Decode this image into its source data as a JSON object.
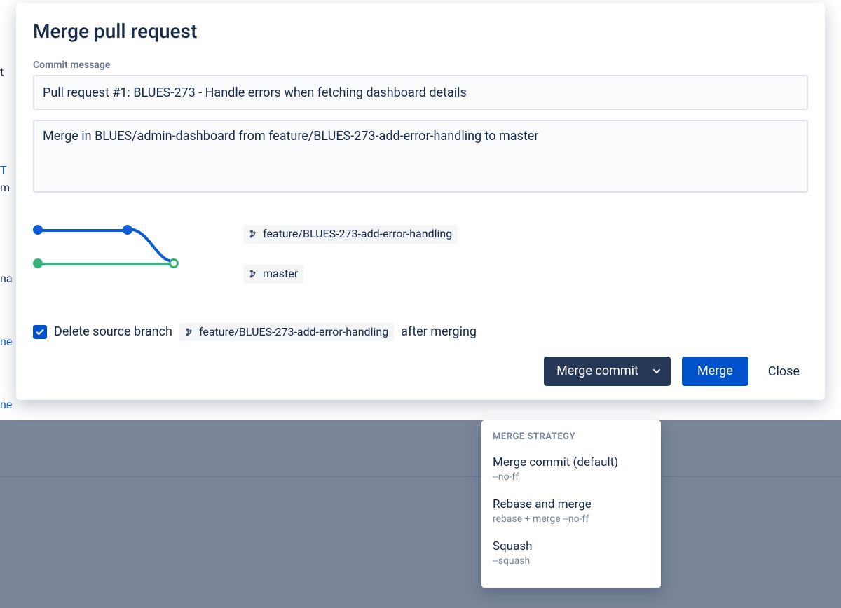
{
  "title": "Merge pull request",
  "field_label": "Commit message",
  "commit_title": "Pull request #1: BLUES-273 - Handle errors when fetching dashboard details",
  "commit_body": "Merge in BLUES/admin-dashboard from feature/BLUES-273-add-error-handling to master",
  "branches": {
    "source": "feature/BLUES-273-add-error-handling",
    "target": "master"
  },
  "delete": {
    "checked": true,
    "prefix": "Delete source branch",
    "branch": "feature/BLUES-273-add-error-handling",
    "suffix": "after merging"
  },
  "buttons": {
    "split_label": "Merge commit",
    "primary": "Merge",
    "close": "Close"
  },
  "menu": {
    "header": "MERGE STRATEGY",
    "items": [
      {
        "name": "Merge commit (default)",
        "sub": "--no-ff"
      },
      {
        "name": "Rebase and merge",
        "sub": "rebase + merge --no-ff"
      },
      {
        "name": "Squash",
        "sub": "--squash"
      }
    ]
  },
  "bg": {
    "t1": "t",
    "t2": "T",
    "t3": "m",
    "t4": "na",
    "t5": "ne",
    "t6": "ne"
  },
  "chart_data": {
    "type": "diagram",
    "description": "Merge graph showing feature branch merging into master",
    "branches": [
      {
        "name": "feature/BLUES-273-add-error-handling",
        "color": "#0B5CD6"
      },
      {
        "name": "master",
        "color": "#36B37E"
      }
    ]
  }
}
